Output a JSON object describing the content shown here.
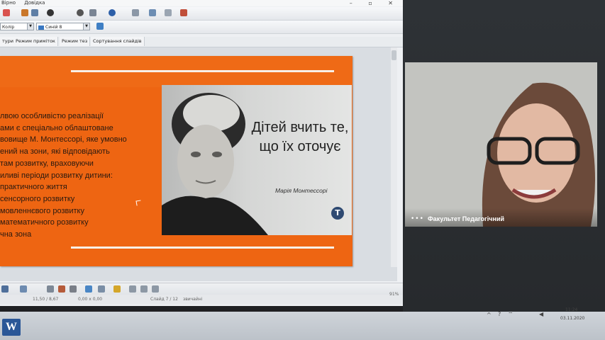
{
  "menubar": {
    "items": [
      "Вірно",
      "Довідка"
    ]
  },
  "toolbar": {
    "color_combo": "Колір",
    "color_value": "Синій 8"
  },
  "tabs": [
    {
      "label": "тури",
      "active": false
    },
    {
      "label": "Режим приміток",
      "active": false
    },
    {
      "label": "Режим тез",
      "active": false
    },
    {
      "label": "Сортування слайдів",
      "active": false
    }
  ],
  "slide": {
    "background_color": "#ee6512",
    "text_lines": [
      "лвою особливістю реалізації",
      "ами є спеціально облаштоване",
      "вовище М. Монтессорі, яке умовно",
      "ений на зони, які відповідають",
      "там розвитку, враховуючи",
      "иливі періоди розвитку дитини:",
      "практичного життя",
      "сенсорного розвитку",
      "мовленнєвого розвитку",
      "математичного розвитку",
      "чна зона"
    ],
    "quote_lines": [
      "Дітей вчить те,",
      "що їх оточує"
    ],
    "quote_author": "Марія Монтессорі",
    "logo_letter": "Т"
  },
  "statusbar": {
    "position": "11,50 / 8,67",
    "size": "0,00 x 0,00",
    "slide_indicator": "Слайд 7 / 12",
    "layout": "звичайні",
    "zoom": "91%"
  },
  "video": {
    "participant_name": "Факультет Педагогічний",
    "more_dots": "•••"
  },
  "taskbar": {
    "word_letter": "W",
    "clock_time": "11:24",
    "clock_date": "03.11.2020"
  }
}
